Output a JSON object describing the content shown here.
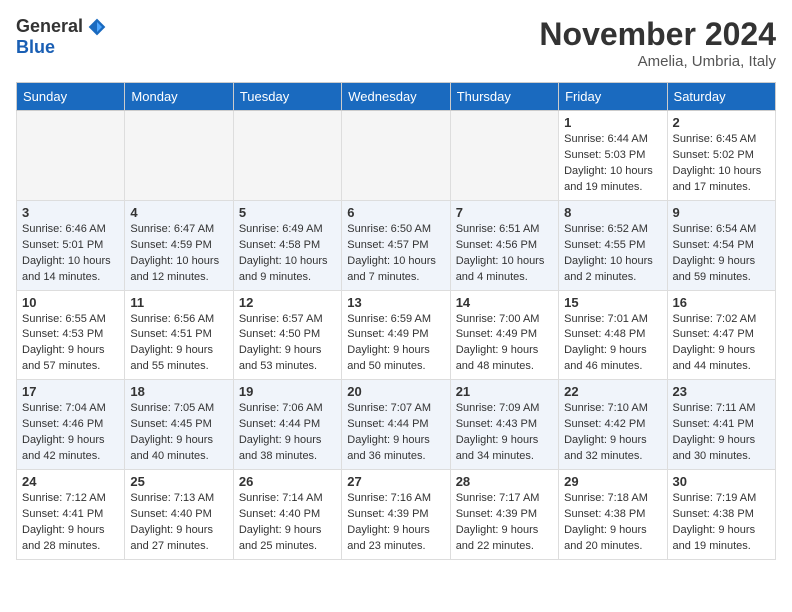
{
  "header": {
    "logo_general": "General",
    "logo_blue": "Blue",
    "month_title": "November 2024",
    "location": "Amelia, Umbria, Italy"
  },
  "days_of_week": [
    "Sunday",
    "Monday",
    "Tuesday",
    "Wednesday",
    "Thursday",
    "Friday",
    "Saturday"
  ],
  "weeks": [
    [
      {
        "day": "",
        "info": "",
        "empty": true
      },
      {
        "day": "",
        "info": "",
        "empty": true
      },
      {
        "day": "",
        "info": "",
        "empty": true
      },
      {
        "day": "",
        "info": "",
        "empty": true
      },
      {
        "day": "",
        "info": "",
        "empty": true
      },
      {
        "day": "1",
        "info": "Sunrise: 6:44 AM\nSunset: 5:03 PM\nDaylight: 10 hours\nand 19 minutes."
      },
      {
        "day": "2",
        "info": "Sunrise: 6:45 AM\nSunset: 5:02 PM\nDaylight: 10 hours\nand 17 minutes."
      }
    ],
    [
      {
        "day": "3",
        "info": "Sunrise: 6:46 AM\nSunset: 5:01 PM\nDaylight: 10 hours\nand 14 minutes."
      },
      {
        "day": "4",
        "info": "Sunrise: 6:47 AM\nSunset: 4:59 PM\nDaylight: 10 hours\nand 12 minutes."
      },
      {
        "day": "5",
        "info": "Sunrise: 6:49 AM\nSunset: 4:58 PM\nDaylight: 10 hours\nand 9 minutes."
      },
      {
        "day": "6",
        "info": "Sunrise: 6:50 AM\nSunset: 4:57 PM\nDaylight: 10 hours\nand 7 minutes."
      },
      {
        "day": "7",
        "info": "Sunrise: 6:51 AM\nSunset: 4:56 PM\nDaylight: 10 hours\nand 4 minutes."
      },
      {
        "day": "8",
        "info": "Sunrise: 6:52 AM\nSunset: 4:55 PM\nDaylight: 10 hours\nand 2 minutes."
      },
      {
        "day": "9",
        "info": "Sunrise: 6:54 AM\nSunset: 4:54 PM\nDaylight: 9 hours\nand 59 minutes."
      }
    ],
    [
      {
        "day": "10",
        "info": "Sunrise: 6:55 AM\nSunset: 4:53 PM\nDaylight: 9 hours\nand 57 minutes."
      },
      {
        "day": "11",
        "info": "Sunrise: 6:56 AM\nSunset: 4:51 PM\nDaylight: 9 hours\nand 55 minutes."
      },
      {
        "day": "12",
        "info": "Sunrise: 6:57 AM\nSunset: 4:50 PM\nDaylight: 9 hours\nand 53 minutes."
      },
      {
        "day": "13",
        "info": "Sunrise: 6:59 AM\nSunset: 4:49 PM\nDaylight: 9 hours\nand 50 minutes."
      },
      {
        "day": "14",
        "info": "Sunrise: 7:00 AM\nSunset: 4:49 PM\nDaylight: 9 hours\nand 48 minutes."
      },
      {
        "day": "15",
        "info": "Sunrise: 7:01 AM\nSunset: 4:48 PM\nDaylight: 9 hours\nand 46 minutes."
      },
      {
        "day": "16",
        "info": "Sunrise: 7:02 AM\nSunset: 4:47 PM\nDaylight: 9 hours\nand 44 minutes."
      }
    ],
    [
      {
        "day": "17",
        "info": "Sunrise: 7:04 AM\nSunset: 4:46 PM\nDaylight: 9 hours\nand 42 minutes."
      },
      {
        "day": "18",
        "info": "Sunrise: 7:05 AM\nSunset: 4:45 PM\nDaylight: 9 hours\nand 40 minutes."
      },
      {
        "day": "19",
        "info": "Sunrise: 7:06 AM\nSunset: 4:44 PM\nDaylight: 9 hours\nand 38 minutes."
      },
      {
        "day": "20",
        "info": "Sunrise: 7:07 AM\nSunset: 4:44 PM\nDaylight: 9 hours\nand 36 minutes."
      },
      {
        "day": "21",
        "info": "Sunrise: 7:09 AM\nSunset: 4:43 PM\nDaylight: 9 hours\nand 34 minutes."
      },
      {
        "day": "22",
        "info": "Sunrise: 7:10 AM\nSunset: 4:42 PM\nDaylight: 9 hours\nand 32 minutes."
      },
      {
        "day": "23",
        "info": "Sunrise: 7:11 AM\nSunset: 4:41 PM\nDaylight: 9 hours\nand 30 minutes."
      }
    ],
    [
      {
        "day": "24",
        "info": "Sunrise: 7:12 AM\nSunset: 4:41 PM\nDaylight: 9 hours\nand 28 minutes."
      },
      {
        "day": "25",
        "info": "Sunrise: 7:13 AM\nSunset: 4:40 PM\nDaylight: 9 hours\nand 27 minutes."
      },
      {
        "day": "26",
        "info": "Sunrise: 7:14 AM\nSunset: 4:40 PM\nDaylight: 9 hours\nand 25 minutes."
      },
      {
        "day": "27",
        "info": "Sunrise: 7:16 AM\nSunset: 4:39 PM\nDaylight: 9 hours\nand 23 minutes."
      },
      {
        "day": "28",
        "info": "Sunrise: 7:17 AM\nSunset: 4:39 PM\nDaylight: 9 hours\nand 22 minutes."
      },
      {
        "day": "29",
        "info": "Sunrise: 7:18 AM\nSunset: 4:38 PM\nDaylight: 9 hours\nand 20 minutes."
      },
      {
        "day": "30",
        "info": "Sunrise: 7:19 AM\nSunset: 4:38 PM\nDaylight: 9 hours\nand 19 minutes."
      }
    ]
  ]
}
